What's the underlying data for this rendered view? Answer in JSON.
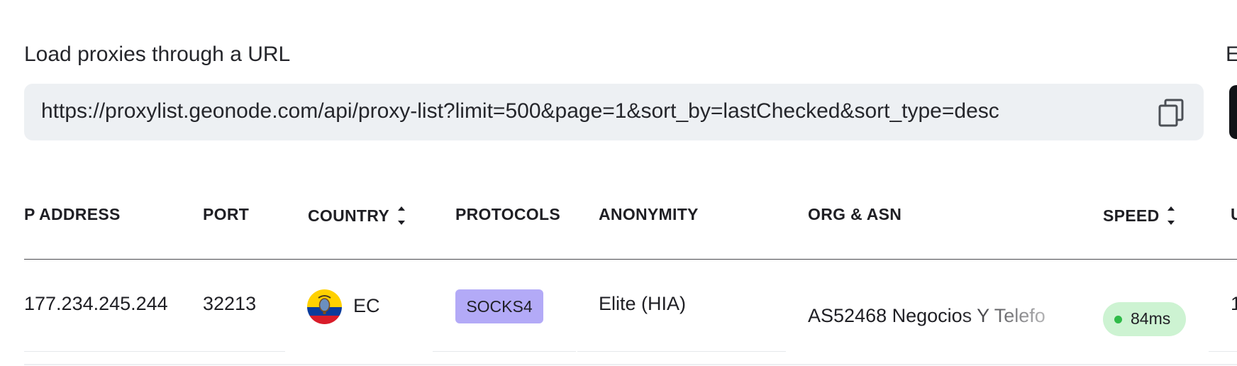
{
  "url_section": {
    "label": "Load proxies through a URL",
    "url": "https://proxylist.geonode.com/api/proxy-list?limit=500&page=1&sort_by=lastChecked&sort_type=desc",
    "copy_icon": "copy-icon",
    "right_label_partial": "E"
  },
  "table": {
    "columns": {
      "ip": "P ADDRESS",
      "port": "PORT",
      "country": "COUNTRY",
      "protocols": "PROTOCOLS",
      "anonymity": "ANONYMITY",
      "org": "ORG & ASN",
      "speed": "SPEED",
      "next_partial": "U"
    },
    "sortable_icon": "sort-updown-icon",
    "rows": [
      {
        "ip": "177.234.245.244",
        "port": "32213",
        "country_flag_icon": "ecuador-flag-icon",
        "country": "EC",
        "protocol": "SOCKS4",
        "anonymity": "Elite (HIA)",
        "org": "AS52468 Negocios Y Telefo",
        "speed": "84ms",
        "next_partial": "1"
      }
    ]
  },
  "colors": {
    "url_box_bg": "#edf0f3",
    "protocol_badge": "#b3aaf7",
    "speed_pill": "#cdf3d2",
    "speed_dot": "#2fbb48"
  }
}
